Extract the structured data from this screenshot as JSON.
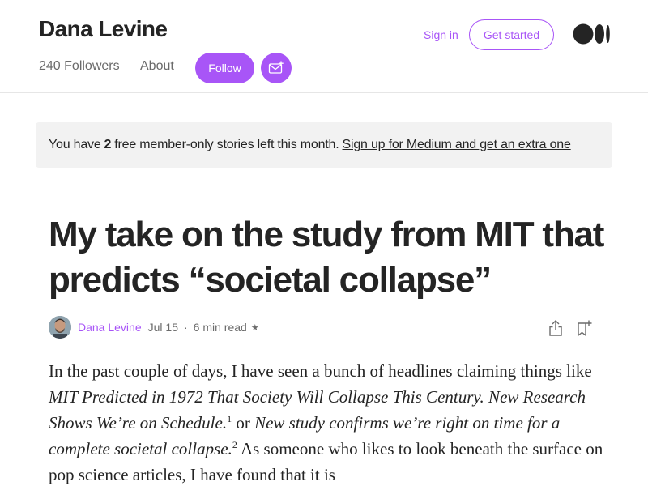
{
  "header": {
    "author_name": "Dana Levine",
    "followers": "240 Followers",
    "about": "About",
    "follow_label": "Follow",
    "sign_in": "Sign in",
    "get_started": "Get started",
    "accent_color": "#a855f7",
    "logo_icon": "medium-logo"
  },
  "banner": {
    "prefix": "You have",
    "count": "2",
    "middle": "free member-only stories left this month.",
    "link": "Sign up for Medium and get an extra one"
  },
  "article": {
    "title": "My take on the study from MIT that predicts “societal collapse”",
    "meta": {
      "author": "Dana Levine",
      "date": "Jul 15",
      "separator": "·",
      "read_time": "6 min read",
      "member_star": "★"
    },
    "body": {
      "p1_a": "In the past couple of days, I have seen a bunch of headlines claiming things like ",
      "p1_i1": "MIT Predicted in 1972 That Society Will Collapse This Century. New Research Shows We’re on Schedule.",
      "sup1": "1",
      "p1_b": " or ",
      "p1_i2": "New study confirms we’re right on time for a complete societal collapse.",
      "sup2": "2",
      "p1_c": " As someone who likes to look beneath the surface on pop science articles, I have found that it is"
    }
  }
}
